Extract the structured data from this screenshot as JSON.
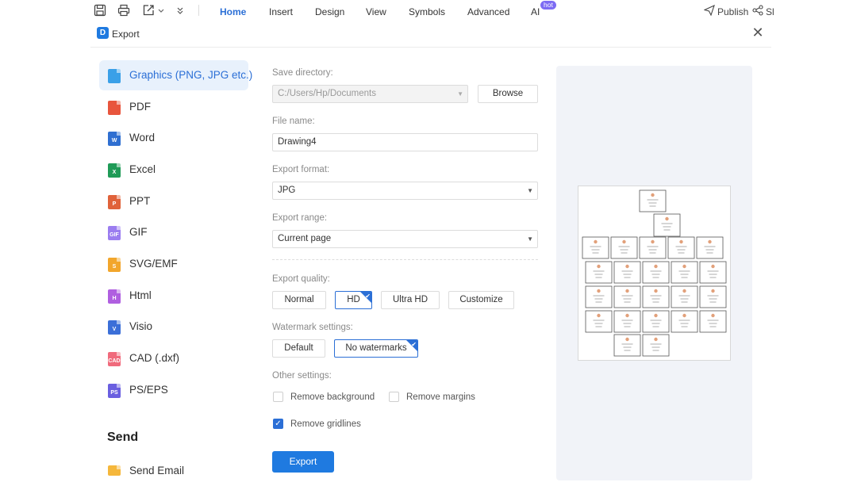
{
  "toolbar": {
    "menus": [
      "Home",
      "Insert",
      "Design",
      "View",
      "Symbols",
      "Advanced",
      "AI"
    ],
    "active_menu": "Home",
    "hot_badge": "hot",
    "publish_label": "Publish",
    "share_label_partial": "Sl"
  },
  "dialog": {
    "title": "Export",
    "close_glyph": "✕"
  },
  "sidebar": {
    "items": [
      {
        "label": "Graphics (PNG, JPG etc.)",
        "icon": "image-file-icon",
        "color": "#3aa0e8",
        "badge": "",
        "active": true
      },
      {
        "label": "PDF",
        "icon": "pdf-file-icon",
        "color": "#e8553d",
        "badge": "",
        "active": false
      },
      {
        "label": "Word",
        "icon": "word-file-icon",
        "color": "#2f6fd1",
        "badge": "W",
        "active": false
      },
      {
        "label": "Excel",
        "icon": "excel-file-icon",
        "color": "#1f9b57",
        "badge": "X",
        "active": false
      },
      {
        "label": "PPT",
        "icon": "ppt-file-icon",
        "color": "#e0623a",
        "badge": "P",
        "active": false
      },
      {
        "label": "GIF",
        "icon": "gif-file-icon",
        "color": "#9b7df0",
        "badge": "GIF",
        "active": false
      },
      {
        "label": "SVG/EMF",
        "icon": "svg-file-icon",
        "color": "#f2a62c",
        "badge": "S",
        "active": false
      },
      {
        "label": "Html",
        "icon": "html-file-icon",
        "color": "#b05fe0",
        "badge": "H",
        "active": false
      },
      {
        "label": "Visio",
        "icon": "visio-file-icon",
        "color": "#3b6fd8",
        "badge": "V",
        "active": false
      },
      {
        "label": "CAD (.dxf)",
        "icon": "cad-file-icon",
        "color": "#f06a7c",
        "badge": "CAD",
        "active": false
      },
      {
        "label": "PS/EPS",
        "icon": "ps-file-icon",
        "color": "#6a5fe0",
        "badge": "PS",
        "active": false
      }
    ],
    "send_heading": "Send",
    "send_items": [
      {
        "label": "Send Email",
        "icon": "email-icon",
        "color": "#f5b73b"
      }
    ]
  },
  "form": {
    "save_dir_label": "Save directory:",
    "save_dir_value": "C:/Users/Hp/Documents",
    "browse_label": "Browse",
    "file_name_label": "File name:",
    "file_name_value": "Drawing4",
    "format_label": "Export format:",
    "format_value": "JPG",
    "range_label": "Export range:",
    "range_value": "Current page",
    "quality_label": "Export quality:",
    "quality_options": [
      "Normal",
      "HD",
      "Ultra HD",
      "Customize"
    ],
    "quality_selected": "HD",
    "watermark_label": "Watermark settings:",
    "watermark_options": [
      "Default",
      "No watermarks"
    ],
    "watermark_selected": "No watermarks",
    "other_label": "Other settings:",
    "remove_background_label": "Remove background",
    "remove_background_checked": false,
    "remove_margins_label": "Remove margins",
    "remove_margins_checked": false,
    "remove_gridlines_label": "Remove gridlines",
    "remove_gridlines_checked": true,
    "export_button_label": "Export"
  },
  "colors": {
    "accent": "#1f7ae0",
    "active_text": "#2b6fd6",
    "preview_bg": "#f1f3f8"
  }
}
